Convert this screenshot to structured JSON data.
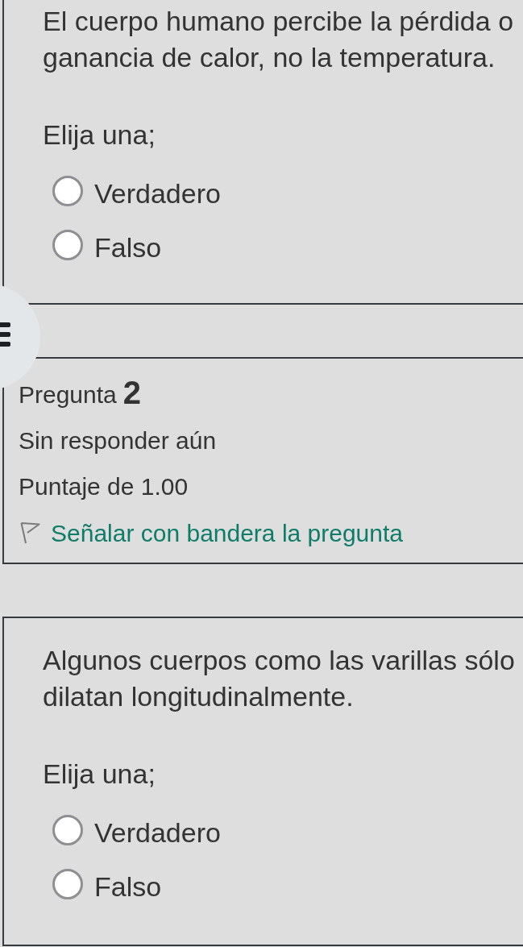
{
  "question_1": {
    "text": "El cuerpo humano percibe la pérdida o ganancia de calor, no la temperatura.",
    "prompt": "Elija una;",
    "options": [
      {
        "label": "Verdadero",
        "selected": false
      },
      {
        "label": "Falso",
        "selected": false
      }
    ]
  },
  "question_2_info": {
    "label": "Pregunta",
    "number": "2",
    "status": "Sin responder aún",
    "grade": "Puntaje de 1.00",
    "flag_link": "Señalar con bandera la pregunta"
  },
  "question_2": {
    "text": "Algunos cuerpos como las varillas sólo dilatan longitudinalmente.",
    "prompt": "Elija una;",
    "options": [
      {
        "label": "Verdadero",
        "selected": false
      },
      {
        "label": "Falso",
        "selected": false
      }
    ]
  }
}
